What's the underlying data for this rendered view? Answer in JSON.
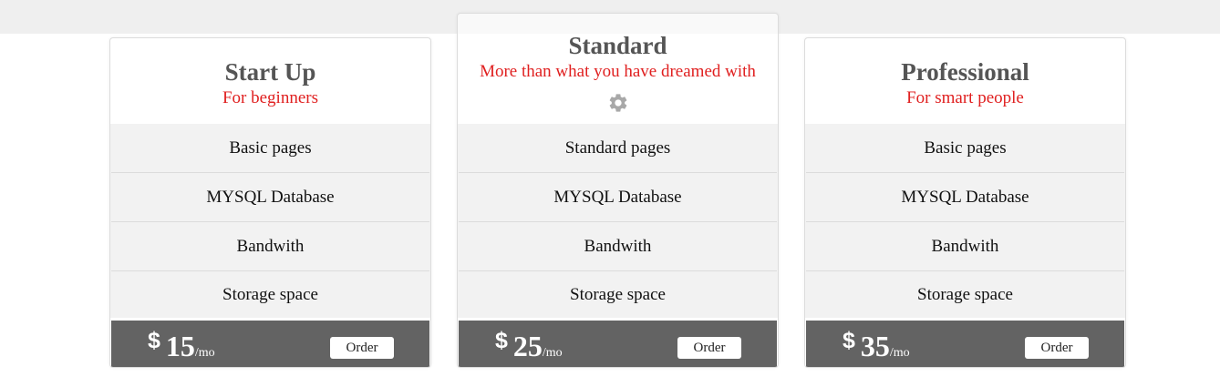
{
  "plans": [
    {
      "title": "Start Up",
      "subtitle": "For beginners",
      "features": [
        "Basic pages",
        "MYSQL Database",
        "Bandwith",
        "Storage space"
      ],
      "currency": "$",
      "price": "15",
      "period": "/mo",
      "order_label": "Order"
    },
    {
      "title": "Standard",
      "subtitle": "More than what you have dreamed with",
      "icon": "gear-icon",
      "features": [
        "Standard pages",
        "MYSQL Database",
        "Bandwith",
        "Storage space"
      ],
      "currency": "$",
      "price": "25",
      "period": "/mo",
      "order_label": "Order"
    },
    {
      "title": "Professional",
      "subtitle": "For smart people",
      "features": [
        "Basic pages",
        "MYSQL Database",
        "Bandwith",
        "Storage space"
      ],
      "currency": "$",
      "price": "35",
      "period": "/mo",
      "order_label": "Order"
    }
  ],
  "colors": {
    "title": "#555555",
    "subtitle": "#e02020",
    "footer": "#636363",
    "feature_bg": "#f2f2f2",
    "topbar": "#efefef"
  }
}
